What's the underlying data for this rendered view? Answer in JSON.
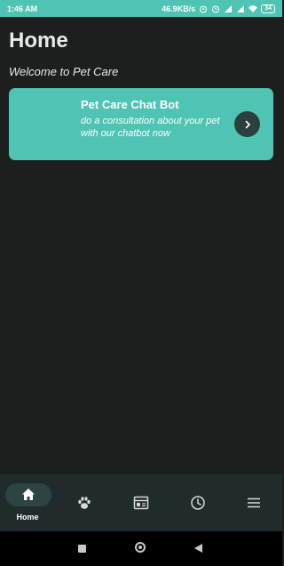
{
  "status_bar": {
    "time": "1:46 AM",
    "speed": "46.9KB/s",
    "battery": "34"
  },
  "header": {
    "title": "Home",
    "subtitle": "Welcome to Pet Care"
  },
  "chatbot_card": {
    "title": "Pet Care Chat Bot",
    "description": "do a consultation about your pet with our chatbot now",
    "button_icon": "chevron-right-icon"
  },
  "bottom_nav": {
    "items": [
      {
        "icon": "home-icon",
        "label": "Home",
        "active": true
      },
      {
        "icon": "paw-icon",
        "label": ""
      },
      {
        "icon": "calendar-icon",
        "label": ""
      },
      {
        "icon": "clock-icon",
        "label": ""
      },
      {
        "icon": "menu-icon",
        "label": ""
      }
    ]
  },
  "colors": {
    "accent": "#4fc4b5",
    "background": "#1b1f1d",
    "nav_background": "#1f2c2b"
  }
}
